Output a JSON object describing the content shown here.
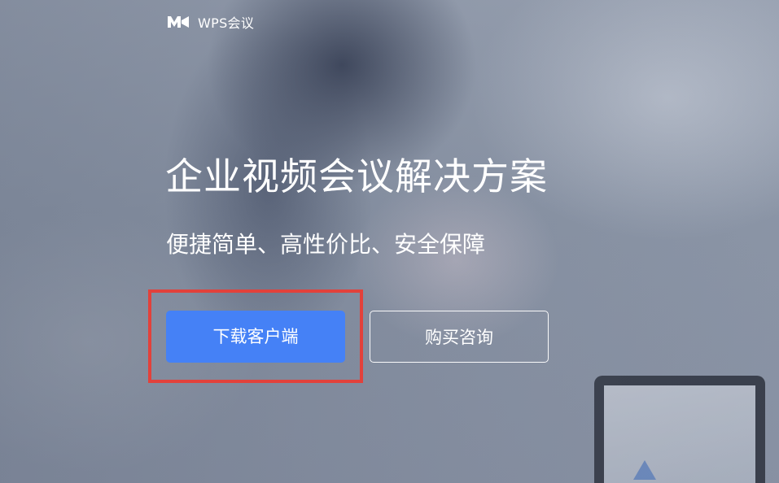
{
  "brand": {
    "logo_icon": "wps-meeting-logo-icon",
    "name": "WPS会议"
  },
  "hero": {
    "title": "企业视频会议解决方案",
    "subtitle": "便捷简单、高性价比、安全保障"
  },
  "actions": {
    "download_label": "下载客户端",
    "consult_label": "购买咨询"
  },
  "colors": {
    "primary_button": "#4581f6",
    "highlight_border": "#e2413b",
    "text": "#ffffff"
  }
}
